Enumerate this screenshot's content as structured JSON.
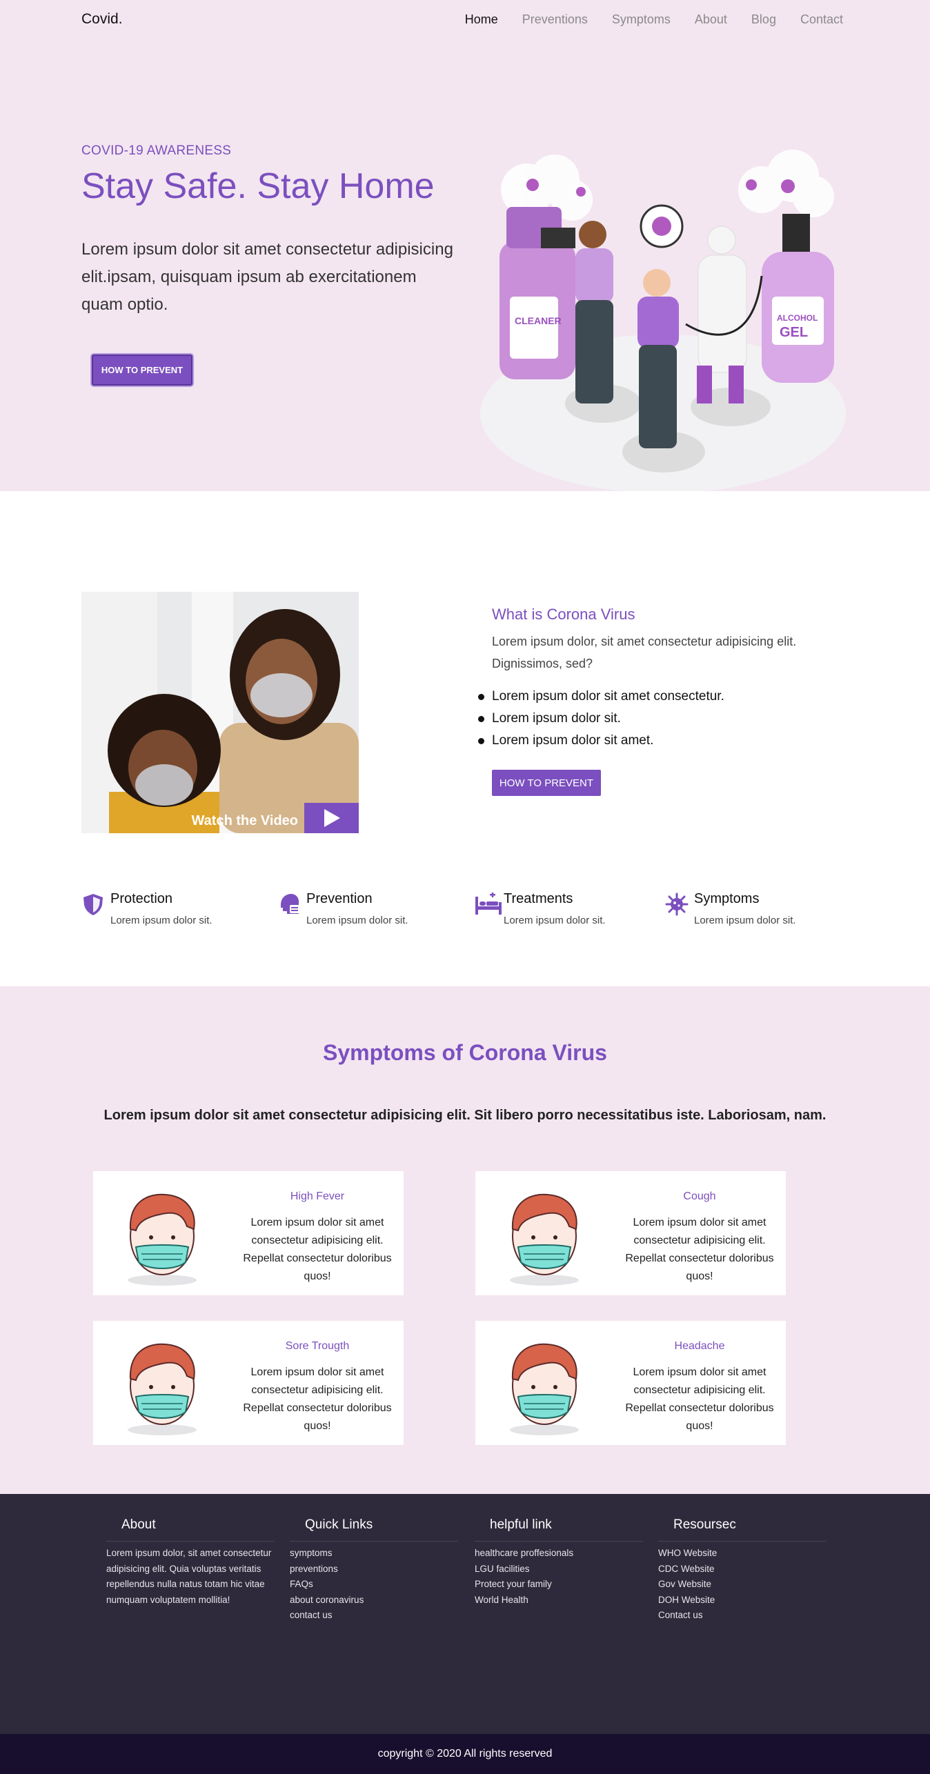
{
  "nav": {
    "brand": "Covid.",
    "links": [
      "Home",
      "Preventions",
      "Symptoms",
      "About",
      "Blog",
      "Contact"
    ]
  },
  "hero": {
    "eyebrow": "COVID-19 AWARENESS",
    "title": "Stay Safe. Stay Home",
    "text": "Lorem ipsum dolor sit amet consectetur adipisicing elit.ipsam, quisquam ipsum ab exercitationem quam optio.",
    "button": "HOW TO PREVENT",
    "illustration_text": [
      "CLEANER",
      "ALCOHOL",
      "GEL"
    ]
  },
  "about": {
    "video_label": "Watch the Video",
    "title": "What is Corona Virus",
    "text": "Lorem ipsum dolor, sit amet consectetur adipisicing elit. Dignissimos, sed?",
    "list": [
      "Lorem ipsum dolor sit amet consectetur.",
      "Lorem ipsum dolor sit.",
      "Lorem ipsum dolor sit amet."
    ],
    "button": "HOW TO PREVENT"
  },
  "features": [
    {
      "title": "Protection",
      "text": "Lorem ipsum dolor sit.",
      "icon": "shield-icon"
    },
    {
      "title": "Prevention",
      "text": "Lorem ipsum dolor sit.",
      "icon": "mask-head-icon"
    },
    {
      "title": "Treatments",
      "text": "Lorem ipsum dolor sit.",
      "icon": "hospital-bed-icon"
    },
    {
      "title": "Symptoms",
      "text": "Lorem ipsum dolor sit.",
      "icon": "virus-icon"
    }
  ],
  "symptoms": {
    "title": "Symptoms of Corona Virus",
    "subtitle": "Lorem ipsum dolor sit amet consectetur adipisicing elit. Sit libero porro necessitatibus iste. Laboriosam, nam.",
    "cards": [
      {
        "title": "High Fever",
        "text": "Lorem ipsum dolor sit amet consectetur adipisicing elit. Repellat consectetur doloribus quos!"
      },
      {
        "title": "Cough",
        "text": "Lorem ipsum dolor sit amet consectetur adipisicing elit. Repellat consectetur doloribus quos!"
      },
      {
        "title": "Sore Trougth",
        "text": "Lorem ipsum dolor sit amet consectetur adipisicing elit. Repellat consectetur doloribus quos!"
      },
      {
        "title": "Headache",
        "text": "Lorem ipsum dolor sit amet consectetur adipisicing elit. Repellat consectetur doloribus quos!"
      }
    ]
  },
  "footer": {
    "about": {
      "title": "About",
      "text": "Lorem ipsum dolor, sit amet consectetur adipisicing elit. Quia voluptas veritatis repellendus nulla natus totam hic vitae numquam voluptatem mollitia!"
    },
    "quick_links": {
      "title": "Quick Links",
      "items": [
        "symptoms",
        "preventions",
        "FAQs",
        "about coronavirus",
        "contact us"
      ]
    },
    "helpful": {
      "title": "helpful link",
      "items": [
        "healthcare proffesionals",
        "LGU facilities",
        "Protect your family",
        "World Health"
      ]
    },
    "resources": {
      "title": "Resoursec",
      "items": [
        "WHO Website",
        "CDC Website",
        "Gov Website",
        "DOH Website",
        "Contact us"
      ]
    },
    "copyright": "copyright © 2020 All rights reserved"
  },
  "colors": {
    "accent": "#7b4fbf",
    "hero_bg": "#f3e6f0",
    "footer_bg": "#2e2a3b",
    "copyright_bg": "#180f2e"
  }
}
